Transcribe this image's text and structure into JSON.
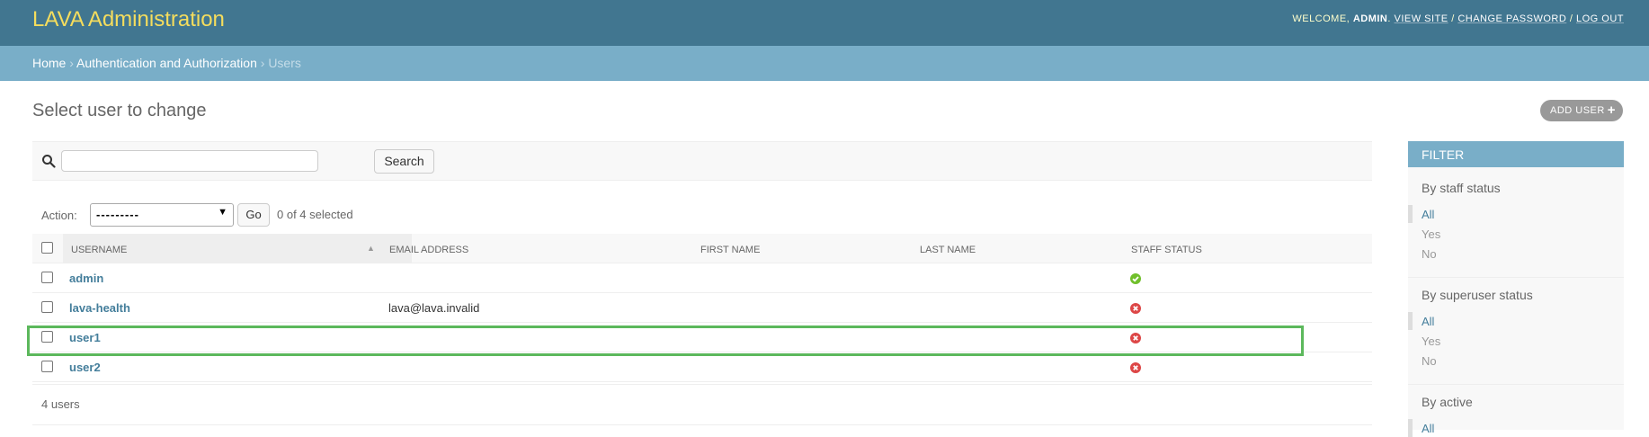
{
  "header": {
    "brand": "LAVA Administration",
    "welcome": "WELCOME,",
    "username": "ADMIN",
    "view_site": "VIEW SITE",
    "change_password": "CHANGE PASSWORD",
    "log_out": "LOG OUT",
    "separator": "/"
  },
  "breadcrumbs": {
    "home": "Home",
    "section": "Authentication and Authorization",
    "current": "Users",
    "arrow": "›"
  },
  "page": {
    "title": "Select user to change",
    "add_button": "ADD USER",
    "add_icon": "plus-icon"
  },
  "search": {
    "value": "",
    "button": "Search",
    "icon": "search-icon"
  },
  "actions": {
    "label": "Action:",
    "selected_option": "---------",
    "go": "Go",
    "selected_count": "0 of 4 selected"
  },
  "table": {
    "columns": [
      "USERNAME",
      "EMAIL ADDRESS",
      "FIRST NAME",
      "LAST NAME",
      "STAFF STATUS"
    ],
    "rows": [
      {
        "username": "admin",
        "email": "",
        "first_name": "",
        "last_name": "",
        "staff": true
      },
      {
        "username": "lava-health",
        "email": "lava@lava.invalid",
        "first_name": "",
        "last_name": "",
        "staff": false
      },
      {
        "username": "user1",
        "email": "",
        "first_name": "",
        "last_name": "",
        "staff": false
      },
      {
        "username": "user2",
        "email": "",
        "first_name": "",
        "last_name": "",
        "staff": false
      }
    ],
    "footer": "4 users"
  },
  "filter": {
    "title": "FILTER",
    "groups": [
      {
        "title": "By staff status",
        "options": [
          "All",
          "Yes",
          "No"
        ],
        "selected": "All"
      },
      {
        "title": "By superuser status",
        "options": [
          "All",
          "Yes",
          "No"
        ],
        "selected": "All"
      },
      {
        "title": "By active",
        "options": [
          "All"
        ],
        "selected": "All"
      }
    ]
  },
  "colors": {
    "header_bg": "#417690",
    "breadcrumb_bg": "#79aec8",
    "link": "#447e9b",
    "brand": "#f5dd5d",
    "highlight": "#5cb85c",
    "yes": "#70bf2b",
    "no": "#dd4646"
  }
}
